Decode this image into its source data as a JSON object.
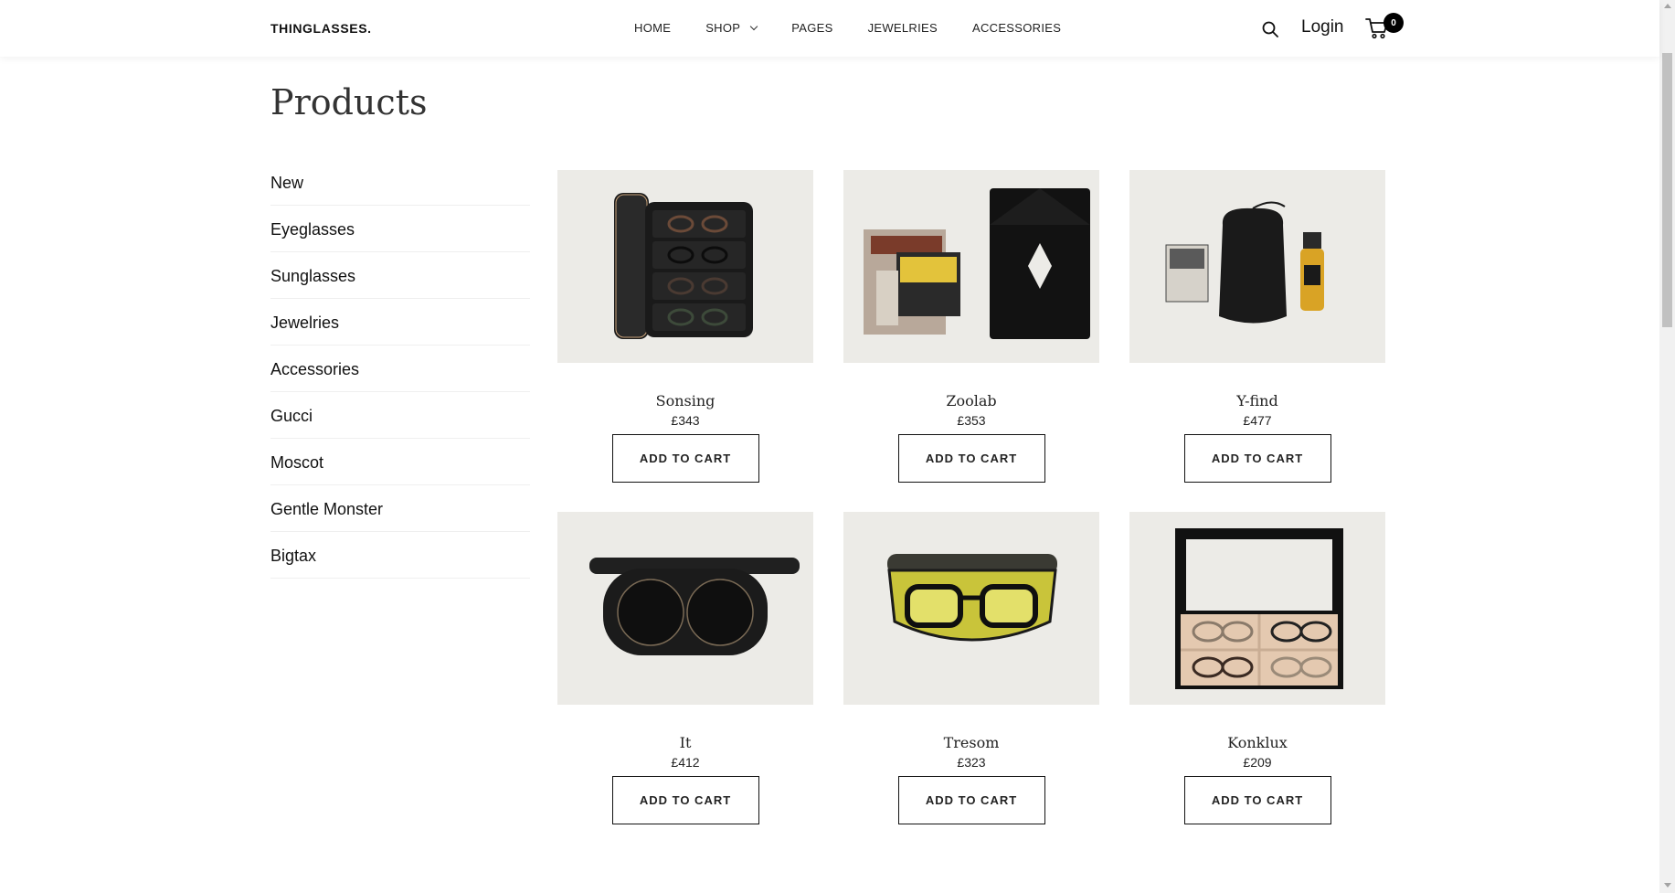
{
  "header": {
    "logo": "THINGLASSES.",
    "nav": [
      {
        "label": "HOME",
        "has_dropdown": false
      },
      {
        "label": "SHOP",
        "has_dropdown": true
      },
      {
        "label": "PAGES",
        "has_dropdown": false
      },
      {
        "label": "JEWELRIES",
        "has_dropdown": false
      },
      {
        "label": "ACCESSORIES",
        "has_dropdown": false
      }
    ],
    "search_icon": "search-icon",
    "login_label": "Login",
    "cart_icon": "cart-icon",
    "cart_count": "0"
  },
  "page_title": "Products",
  "sidebar": {
    "items": [
      {
        "label": "New"
      },
      {
        "label": "Eyeglasses"
      },
      {
        "label": "Sunglasses"
      },
      {
        "label": "Jewelries"
      },
      {
        "label": "Accessories"
      },
      {
        "label": "Gucci"
      },
      {
        "label": "Moscot"
      },
      {
        "label": "Gentle Monster"
      },
      {
        "label": "Bigtax"
      }
    ]
  },
  "products": [
    {
      "name": "Sonsing",
      "price": "£343",
      "button": "ADD TO CART",
      "image": "eyewear-organizer-case"
    },
    {
      "name": "Zoolab",
      "price": "£353",
      "button": "ADD TO CART",
      "image": "moscot-cleaning-cloth-and-envelope"
    },
    {
      "name": "Y-find",
      "price": "£477",
      "button": "ADD TO CART",
      "image": "moscot-pouch-and-lens-spray"
    },
    {
      "name": "It",
      "price": "£412",
      "button": "ADD TO CART",
      "image": "clip-on-sunglasses-case"
    },
    {
      "name": "Tresom",
      "price": "£323",
      "button": "ADD TO CART",
      "image": "eyeglasses-in-yellow-case"
    },
    {
      "name": "Konklux",
      "price": "£209",
      "button": "ADD TO CART",
      "image": "eyewear-display-box"
    }
  ],
  "colors": {
    "accent": "#111111",
    "thumb_bg": "#ecebe7",
    "divider": "#efefef"
  }
}
